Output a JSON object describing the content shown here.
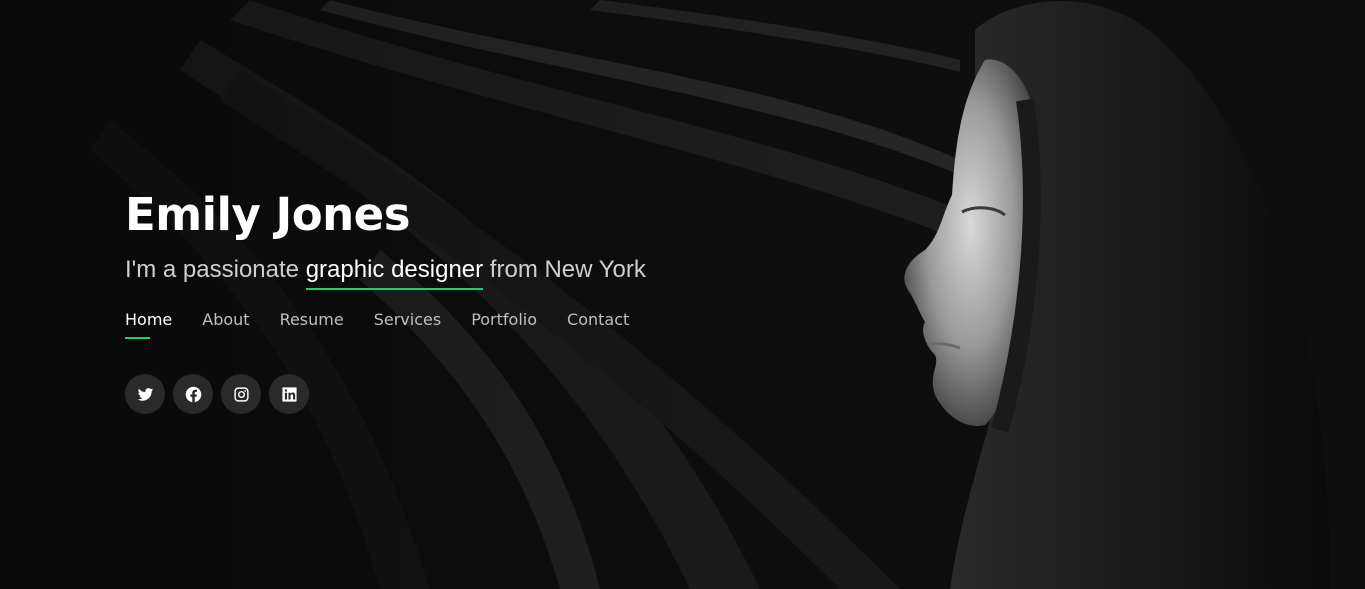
{
  "hero": {
    "name": "Emily Jones",
    "tagline_prefix": "I'm a passionate ",
    "tagline_highlight": "graphic designer",
    "tagline_suffix": " from New York",
    "accent_color": "#18d26e",
    "background_image": "black-and-white photo of a woman in profile beside curved concrete steps"
  },
  "nav": {
    "items": [
      {
        "label": "Home",
        "active": true
      },
      {
        "label": "About",
        "active": false
      },
      {
        "label": "Resume",
        "active": false
      },
      {
        "label": "Services",
        "active": false
      },
      {
        "label": "Portfolio",
        "active": false
      },
      {
        "label": "Contact",
        "active": false
      }
    ]
  },
  "social": {
    "icons": [
      "twitter-icon",
      "facebook-icon",
      "instagram-icon",
      "linkedin-icon"
    ]
  }
}
